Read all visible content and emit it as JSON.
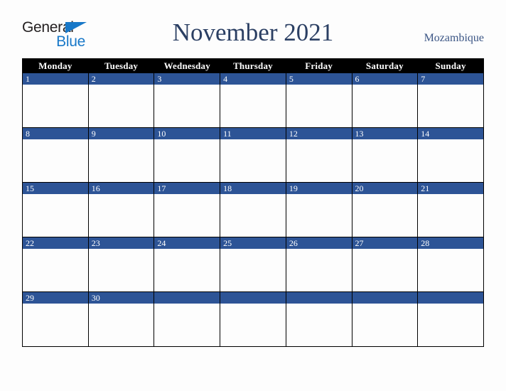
{
  "page": {
    "background_color": "#fdfdfd"
  },
  "logo": {
    "name": "general-blue-logo",
    "line1": "General",
    "line2": "Blue",
    "line1_color": "#231f20",
    "line2_color": "#1878c8",
    "triangle_color": "#1878c8"
  },
  "header": {
    "title": "November 2021",
    "title_color": "#2b3f63",
    "country": "Mozambique",
    "country_color": "#3c5685"
  },
  "calendar": {
    "header_background": "#000000",
    "header_text_color": "#ffffff",
    "day_banner_color": "#2d5496",
    "day_number_color": "#ffffff",
    "cell_background": "#fdfdfd",
    "border_color": "#000000",
    "weekdays": [
      "Monday",
      "Tuesday",
      "Wednesday",
      "Thursday",
      "Friday",
      "Saturday",
      "Sunday"
    ],
    "weeks": [
      [
        "1",
        "2",
        "3",
        "4",
        "5",
        "6",
        "7"
      ],
      [
        "8",
        "9",
        "10",
        "11",
        "12",
        "13",
        "14"
      ],
      [
        "15",
        "16",
        "17",
        "18",
        "19",
        "20",
        "21"
      ],
      [
        "22",
        "23",
        "24",
        "25",
        "26",
        "27",
        "28"
      ],
      [
        "29",
        "30",
        "",
        "",
        "",
        "",
        ""
      ]
    ]
  }
}
